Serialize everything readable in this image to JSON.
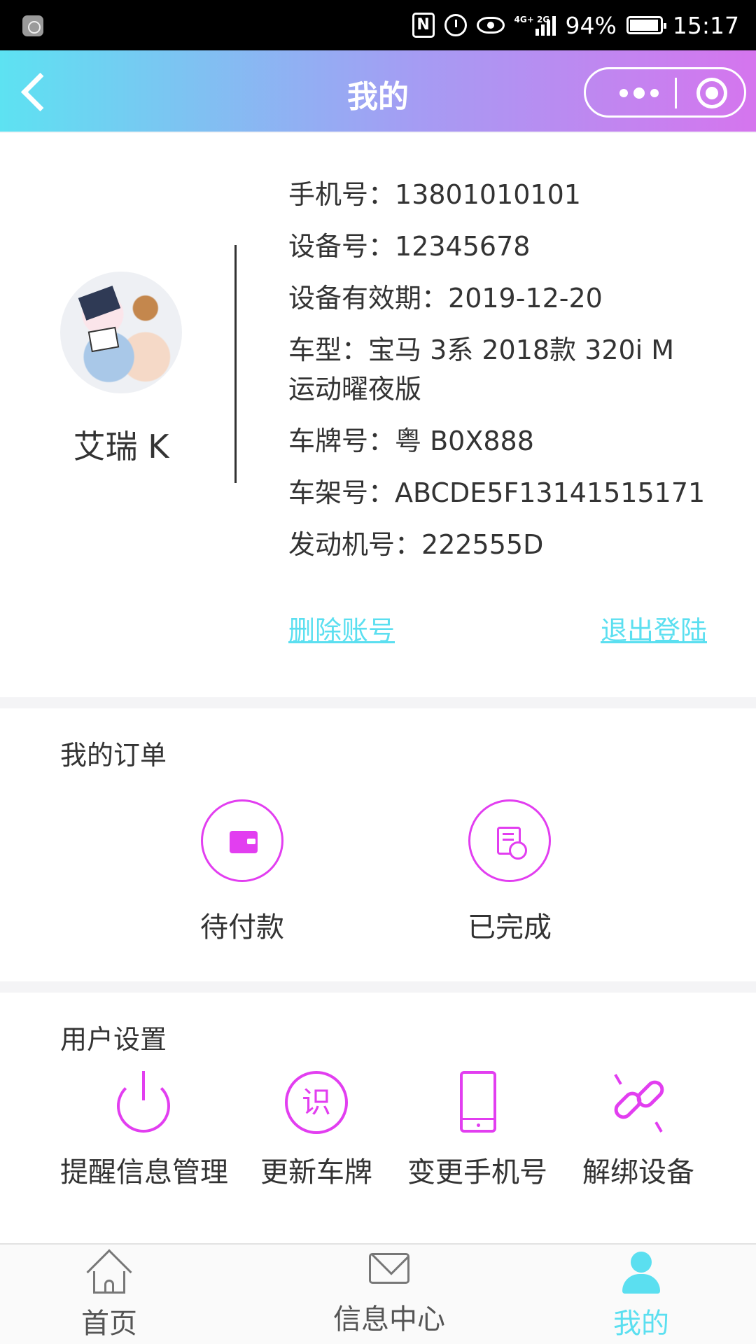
{
  "status_bar": {
    "network": "4G+ 2G",
    "battery": "94%",
    "time": "15:17",
    "icons": [
      "app-icon",
      "nfc-icon",
      "alarm-clock-icon",
      "eye-comfort-icon",
      "signal-icon",
      "battery-icon"
    ]
  },
  "header": {
    "title": "我的",
    "icons": [
      "back-chevron-icon",
      "more-dots-icon",
      "close-mini-program-icon"
    ]
  },
  "profile": {
    "name": "艾瑞 K",
    "fields": [
      {
        "label": "手机号：",
        "value": "13801010101"
      },
      {
        "label": "设备号：",
        "value": "12345678"
      },
      {
        "label": "设备有效期：",
        "value": "2019-12-20"
      },
      {
        "label": "车型：",
        "value": "宝马 3系 2018款 320i M 运动曜夜版"
      },
      {
        "label": "车牌号：",
        "value": "粤 B0X888"
      },
      {
        "label": "车架号：",
        "value": "ABCDE5F13141515171"
      },
      {
        "label": "发动机号：",
        "value": "222555D"
      }
    ],
    "delete_account": "删除账号",
    "logout": "退出登陆"
  },
  "orders": {
    "title": "我的订单",
    "items": [
      {
        "label": "待付款",
        "icon": "wallet-icon"
      },
      {
        "label": "已完成",
        "icon": "completed-document-icon"
      }
    ]
  },
  "settings": {
    "title": "用户设置",
    "items": [
      {
        "label": "提醒信息管理",
        "icon": "power-icon"
      },
      {
        "label": "更新车牌",
        "icon": "plate-recognize-icon",
        "glyph": "识"
      },
      {
        "label": "变更手机号",
        "icon": "phone-icon"
      },
      {
        "label": "解绑设备",
        "icon": "unlink-icon"
      }
    ]
  },
  "tab_bar": {
    "tabs": [
      {
        "label": "首页",
        "icon": "home-icon"
      },
      {
        "label": "信息中心",
        "icon": "mail-icon"
      },
      {
        "label": "我的",
        "icon": "person-icon",
        "active": true
      }
    ]
  },
  "colors": {
    "accent_cyan": "#5bdff0",
    "accent_magenta": "#e23ef0",
    "header_gradient": [
      "#5de2f2",
      "#a59cf3",
      "#d575ee"
    ]
  }
}
